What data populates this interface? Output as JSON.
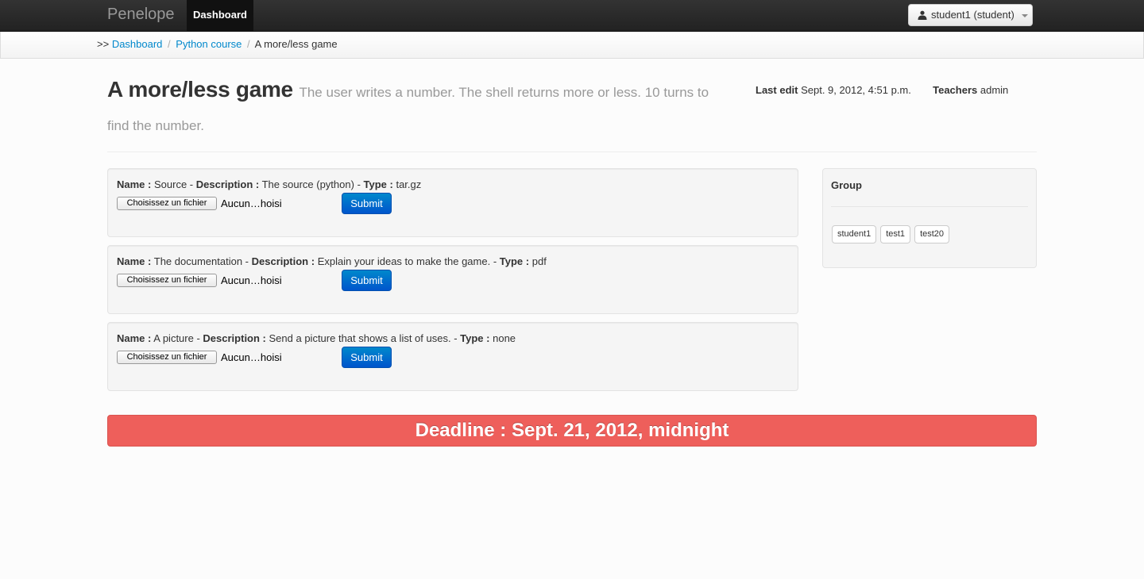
{
  "nav": {
    "brand": "Penelope",
    "active_item": "Dashboard",
    "user_menu": "student1 (student)"
  },
  "breadcrumb": {
    "prefix": ">>",
    "items": [
      "Dashboard",
      "Python course",
      "A more/less game"
    ]
  },
  "header": {
    "title": "A more/less game",
    "subtitle": "The user writes a number. The shell returns more or less. 10 turns to find the number.",
    "last_edit_label": "Last edit",
    "last_edit_value": "Sept. 9, 2012, 4:51 p.m.",
    "teachers_label": "Teachers",
    "teachers_value": "admin"
  },
  "labels": {
    "name": "Name :",
    "description": "Description :",
    "type": "Type :",
    "dash": " - ",
    "choose_file": "Choisissez un fichier",
    "no_file": "Aucun…hoisi",
    "submit": "Submit"
  },
  "uploads": [
    {
      "name": "Source",
      "description": "The source (python)",
      "type": "tar.gz"
    },
    {
      "name": "The documentation",
      "description": "Explain your ideas to make the game.",
      "type": "pdf"
    },
    {
      "name": "A picture",
      "description": "Send a picture that shows a list of uses.",
      "type": "none"
    }
  ],
  "group": {
    "title": "Group",
    "members": [
      "student1",
      "test1",
      "test20"
    ]
  },
  "deadline": "Deadline : Sept. 21, 2012, midnight",
  "colors": {
    "navbar": "#222222",
    "link": "#0088cc",
    "submit": "#0070cc",
    "deadline": "#ee5f5b"
  }
}
